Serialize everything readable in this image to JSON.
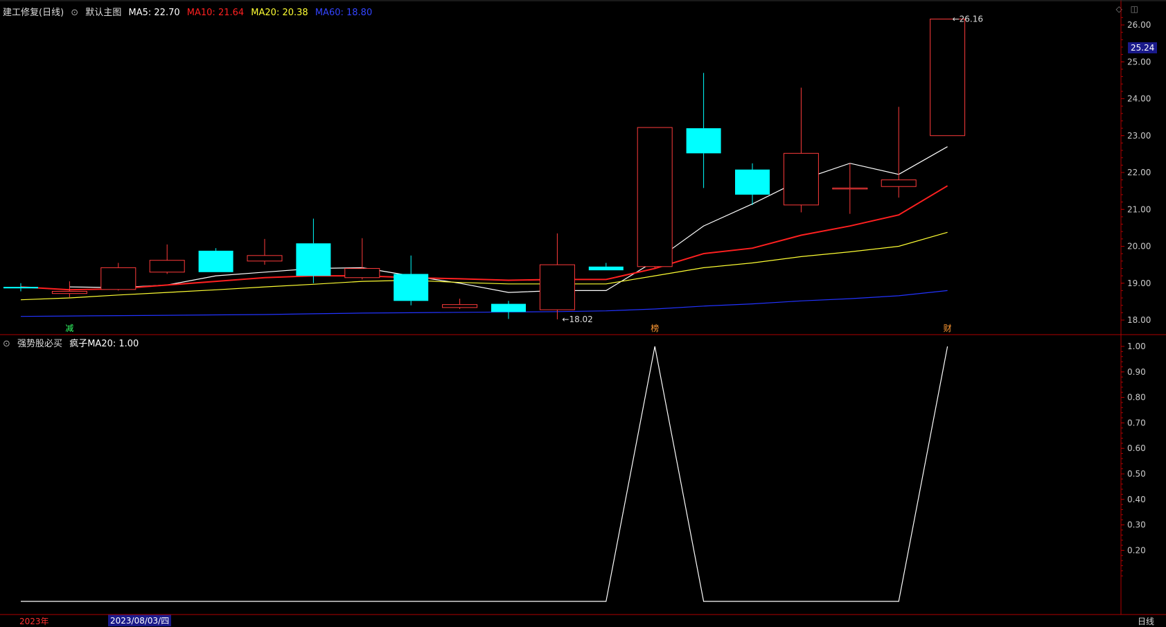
{
  "title": "建工修复(日线)",
  "main_chart_label": "默认主图",
  "ma_labels": [
    {
      "name": "MA5",
      "value": "22.70",
      "color": "#ffffff"
    },
    {
      "name": "MA10",
      "value": "21.64",
      "color": "#ff2020"
    },
    {
      "name": "MA20",
      "value": "20.38",
      "color": "#ffff33"
    },
    {
      "name": "MA60",
      "value": "18.80",
      "color": "#2233ff"
    }
  ],
  "indicator_title": "强势股必买",
  "indicator_value_label": "疯子MA20: 1.00",
  "current_price": "25.24",
  "year_label": "2023年",
  "date_label": "2023/08/03/四",
  "period_label": "日线",
  "colors": {
    "up": "#ff3b3b",
    "down": "#00ffff",
    "axis": "#b00000",
    "ma5": "#ffffff",
    "ma10": "#ff2020",
    "ma20": "#ffff33",
    "ma60": "#2233ff"
  },
  "chart_data": [
    {
      "type": "candlestick",
      "title": "建工修复(日线)",
      "ylim": [
        17.8,
        26.4
      ],
      "y_ticks": [
        18.0,
        19.0,
        20.0,
        21.0,
        22.0,
        23.0,
        24.0,
        25.0,
        26.0
      ],
      "candles": [
        {
          "o": 18.9,
          "h": 19.0,
          "l": 18.78,
          "c": 18.86
        },
        {
          "o": 18.72,
          "h": 19.05,
          "l": 18.62,
          "c": 18.78
        },
        {
          "o": 18.83,
          "h": 19.55,
          "l": 18.8,
          "c": 19.42
        },
        {
          "o": 19.3,
          "h": 20.05,
          "l": 19.25,
          "c": 19.62
        },
        {
          "o": 19.88,
          "h": 19.95,
          "l": 19.3,
          "c": 19.3
        },
        {
          "o": 19.6,
          "h": 20.2,
          "l": 19.5,
          "c": 19.75
        },
        {
          "o": 20.08,
          "h": 20.75,
          "l": 19.0,
          "c": 19.2
        },
        {
          "o": 19.15,
          "h": 20.22,
          "l": 19.1,
          "c": 19.4
        },
        {
          "o": 19.25,
          "h": 19.75,
          "l": 18.4,
          "c": 18.52
        },
        {
          "o": 18.34,
          "h": 18.58,
          "l": 18.3,
          "c": 18.42
        },
        {
          "o": 18.44,
          "h": 18.52,
          "l": 18.03,
          "c": 18.22
        },
        {
          "o": 18.28,
          "h": 20.35,
          "l": 18.02,
          "c": 19.5
        },
        {
          "o": 19.45,
          "h": 19.55,
          "l": 19.35,
          "c": 19.35
        },
        {
          "o": 19.45,
          "h": 23.22,
          "l": 19.4,
          "c": 23.22
        },
        {
          "o": 23.2,
          "h": 24.7,
          "l": 21.58,
          "c": 22.52
        },
        {
          "o": 22.08,
          "h": 22.25,
          "l": 21.12,
          "c": 21.4
        },
        {
          "o": 21.12,
          "h": 24.3,
          "l": 20.92,
          "c": 22.52
        },
        {
          "o": 21.58,
          "h": 22.25,
          "l": 20.88,
          "c": 21.58
        },
        {
          "o": 21.62,
          "h": 23.78,
          "l": 21.32,
          "c": 21.8
        },
        {
          "o": 23.0,
          "h": 26.16,
          "l": 23.0,
          "c": 26.16
        }
      ],
      "series": [
        {
          "name": "MA5",
          "values": [
            18.9,
            18.88,
            18.95,
            19.2,
            19.3,
            19.4,
            19.42,
            19.2,
            19.0,
            18.75,
            18.8,
            18.8,
            19.6,
            20.55,
            21.15,
            21.8,
            22.25,
            21.95,
            22.7
          ]
        },
        {
          "name": "MA10",
          "values": [
            18.9,
            18.82,
            18.85,
            18.95,
            19.05,
            19.15,
            19.2,
            19.2,
            19.15,
            19.12,
            19.08,
            19.1,
            19.1,
            19.4,
            19.8,
            19.95,
            20.3,
            20.55,
            20.85,
            21.64
          ]
        },
        {
          "name": "MA20",
          "values": [
            18.55,
            18.6,
            18.68,
            18.75,
            18.82,
            18.9,
            18.97,
            19.05,
            19.08,
            19.02,
            18.98,
            18.98,
            18.98,
            19.2,
            19.42,
            19.55,
            19.72,
            19.85,
            20.0,
            20.38
          ]
        },
        {
          "name": "MA60",
          "values": [
            18.1,
            18.11,
            18.12,
            18.13,
            18.14,
            18.15,
            18.17,
            18.19,
            18.2,
            18.21,
            18.22,
            18.23,
            18.25,
            18.3,
            18.38,
            18.44,
            18.52,
            18.58,
            18.66,
            18.8
          ]
        }
      ],
      "annotations": [
        {
          "index": 11,
          "value": 18.02,
          "label": "18.02"
        },
        {
          "index": 19,
          "value": 26.16,
          "label": "26.16"
        }
      ],
      "markers": [
        {
          "index": 1,
          "label": "减"
        },
        {
          "index": 13,
          "label": "榜"
        },
        {
          "index": 19,
          "label": "财"
        }
      ]
    },
    {
      "type": "line",
      "title": "强势股必买",
      "ylim": [
        0,
        1.05
      ],
      "y_ticks": [
        0.2,
        0.3,
        0.4,
        0.5,
        0.6,
        0.7,
        0.8,
        0.9,
        1.0
      ],
      "series": [
        {
          "name": "疯子MA20",
          "values": [
            0,
            0,
            0,
            0,
            0,
            0,
            0,
            0,
            0,
            0,
            0,
            0,
            0,
            1,
            0,
            0,
            0,
            0,
            0,
            1
          ]
        }
      ]
    }
  ]
}
